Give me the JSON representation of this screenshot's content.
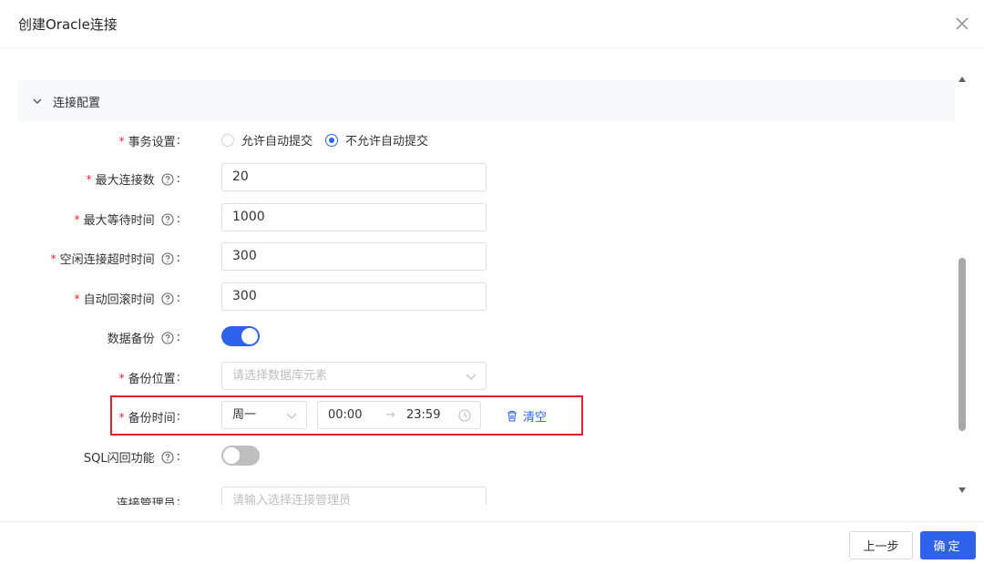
{
  "dialog": {
    "title": "创建Oracle连接"
  },
  "section": {
    "title": "连接配置"
  },
  "form": {
    "transaction": {
      "label": "事务设置",
      "options": [
        "允许自动提交",
        "不允许自动提交"
      ],
      "selected": "不允许自动提交"
    },
    "max_connections": {
      "label": "最大连接数",
      "value": "20"
    },
    "max_wait": {
      "label": "最大等待时间",
      "value": "1000"
    },
    "idle_timeout": {
      "label": "空闲连接超时时间",
      "value": "300"
    },
    "auto_rollback": {
      "label": "自动回滚时间",
      "value": "300"
    },
    "data_backup": {
      "label": "数据备份",
      "enabled": true
    },
    "backup_location": {
      "label": "备份位置",
      "placeholder": "请选择数据库元素"
    },
    "backup_time": {
      "label": "备份时间",
      "day": "周一",
      "start": "00:00",
      "arrow": "→",
      "end": "23:59",
      "clear_label": "清空"
    },
    "sql_flashback": {
      "label": "SQL闪回功能",
      "enabled": false
    },
    "connection_manager": {
      "label": "连接管理员",
      "placeholder": "请输入选择连接管理员"
    }
  },
  "colon": ":",
  "required_mark": "*",
  "footer": {
    "prev_label": "上一步",
    "ok_label": "确定"
  },
  "colors": {
    "accent": "#2f62ea",
    "required": "#f5222d",
    "highlight": "#e3242b"
  },
  "icons": [
    "close-icon",
    "chevron-down-icon",
    "help-icon",
    "clock-icon",
    "trash-icon",
    "scroll-up-icon",
    "scroll-down-icon"
  ]
}
